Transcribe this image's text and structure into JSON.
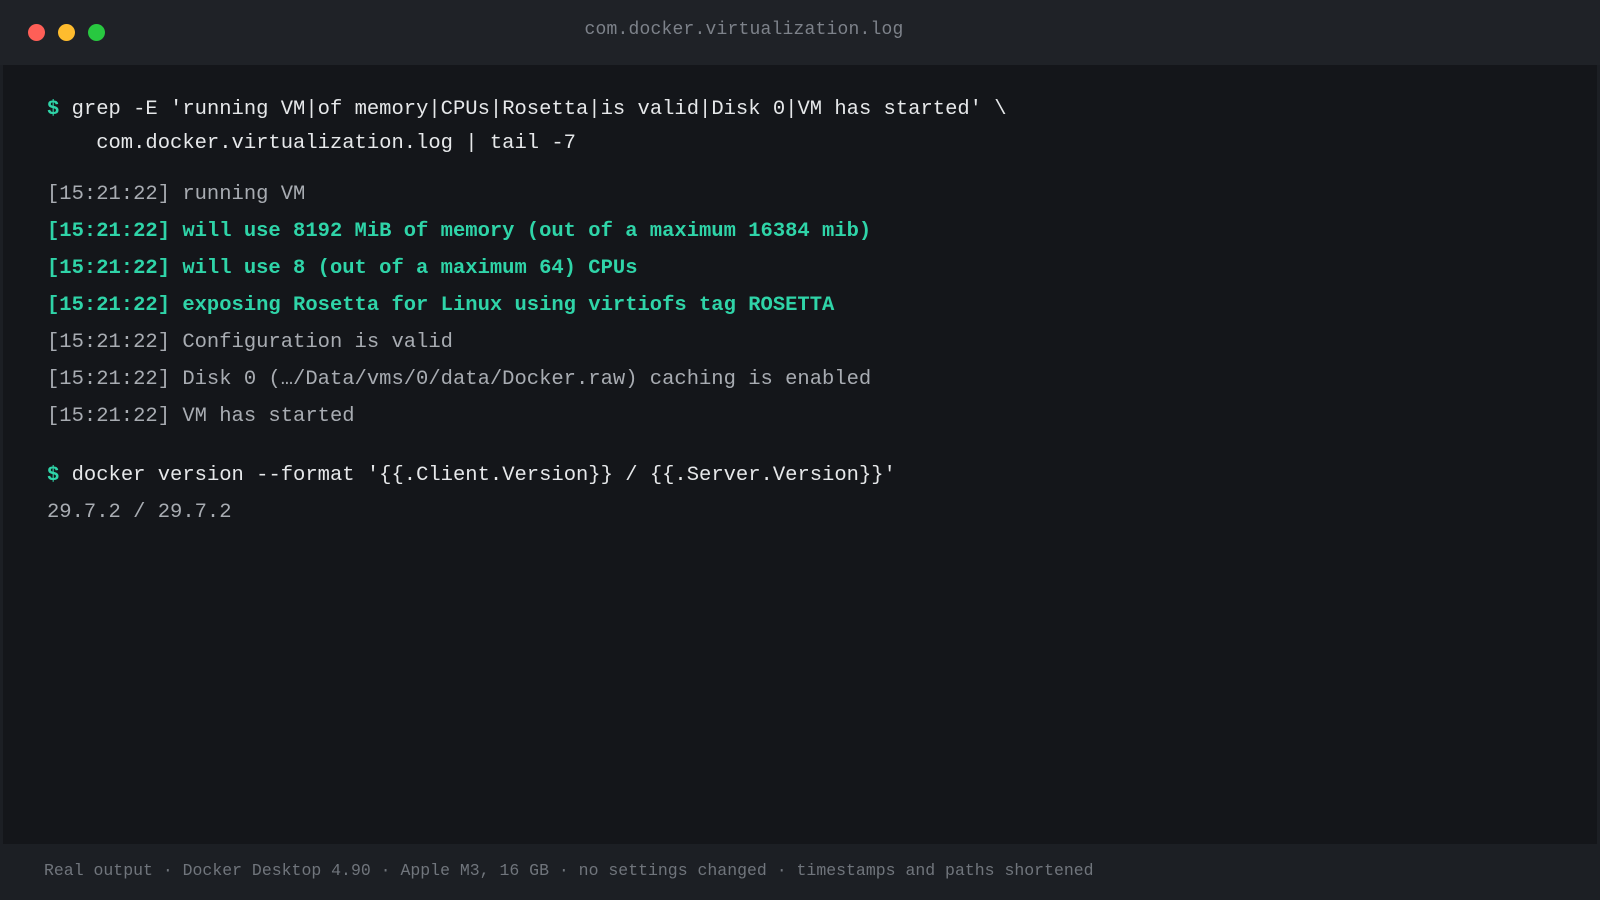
{
  "window": {
    "title": "com.docker.virtualization.log",
    "controls": {
      "close_color": "#fe5f57",
      "minimize_color": "#febc2e",
      "zoom_color": "#28c840"
    }
  },
  "terminal": {
    "prompt_symbol": "$",
    "command1": {
      "line1": "grep -E 'running VM|of memory|CPUs|Rosetta|is valid|Disk 0|VM has started' \\",
      "line2": "    com.docker.virtualization.log | tail -7"
    },
    "log_lines": [
      "[15:21:22] running VM",
      "[15:21:22] will use 8192 MiB of memory (out of a maximum 16384 mib)",
      "[15:21:22] will use 8 (out of a maximum 64) CPUs",
      "[15:21:22] exposing Rosetta for Linux using virtiofs tag ROSETTA",
      "[15:21:22] Configuration is valid",
      "[15:21:22] Disk 0 (…/Data/vms/0/data/Docker.raw) caching is enabled",
      "[15:21:22] VM has started"
    ],
    "command2": "docker version --format '{{.Client.Version}} / {{.Server.Version}}'",
    "command2_output": "29.7.2 / 29.7.2",
    "highlight_color": "#2fd4a8"
  },
  "footer": {
    "caption": "Real output · Docker Desktop 4.90 · Apple M3, 16 GB · no settings changed · timestamps and paths shortened"
  }
}
